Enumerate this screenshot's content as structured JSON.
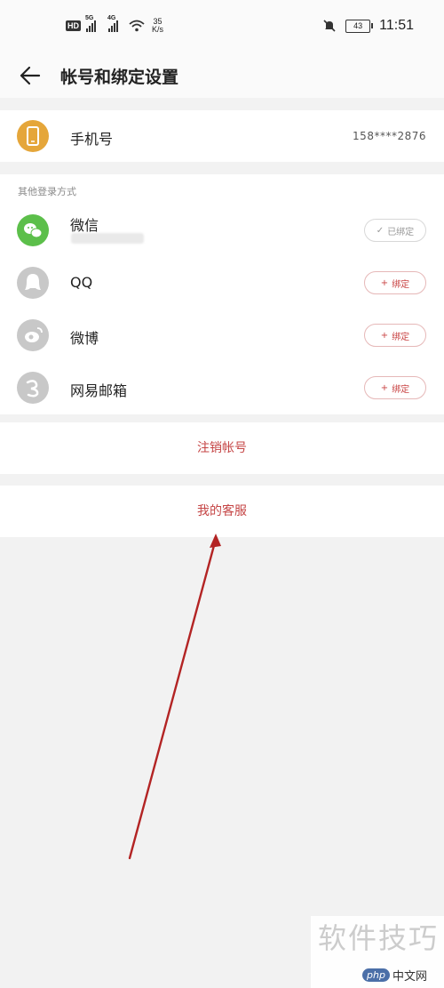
{
  "status_bar": {
    "hd_badge": "HD",
    "signal1_tag": "5G",
    "signal2_tag": "4G",
    "speed_value": "35",
    "speed_unit": "K/s",
    "battery_level": "43",
    "time": "11:51",
    "icons": [
      "hd-icon",
      "cellular-signal-icon",
      "wifi-icon",
      "mute-bell-icon",
      "battery-icon"
    ]
  },
  "header": {
    "title": "帐号和绑定设置",
    "back_icon": "arrow-left-icon"
  },
  "phone": {
    "label": "手机号",
    "value": "158****2876",
    "icon": "phone-icon",
    "icon_color": "#e5a63a"
  },
  "other_login": {
    "section_label": "其他登录方式",
    "items": [
      {
        "label": "微信",
        "status": "已绑定",
        "bound": true,
        "icon": "wechat-icon",
        "icon_color": "#5cbf4a"
      },
      {
        "label": "QQ",
        "status": "绑定",
        "bound": false,
        "icon": "qq-icon",
        "icon_color": "#c8c8c8"
      },
      {
        "label": "微博",
        "status": "绑定",
        "bound": false,
        "icon": "weibo-icon",
        "icon_color": "#c8c8c8"
      },
      {
        "label": "网易邮箱",
        "status": "绑定",
        "bound": false,
        "icon": "netease-mail-icon",
        "icon_color": "#c8c8c8"
      }
    ]
  },
  "actions": {
    "cancel_account": "注销帐号",
    "customer_service": "我的客服"
  },
  "annotation": {
    "arrow_color": "#b32424"
  },
  "watermark": {
    "text": "软件技巧",
    "logo_php": "php",
    "logo_cn": "中文网"
  },
  "colors": {
    "accent": "#c54545",
    "background": "#f2f2f2"
  }
}
